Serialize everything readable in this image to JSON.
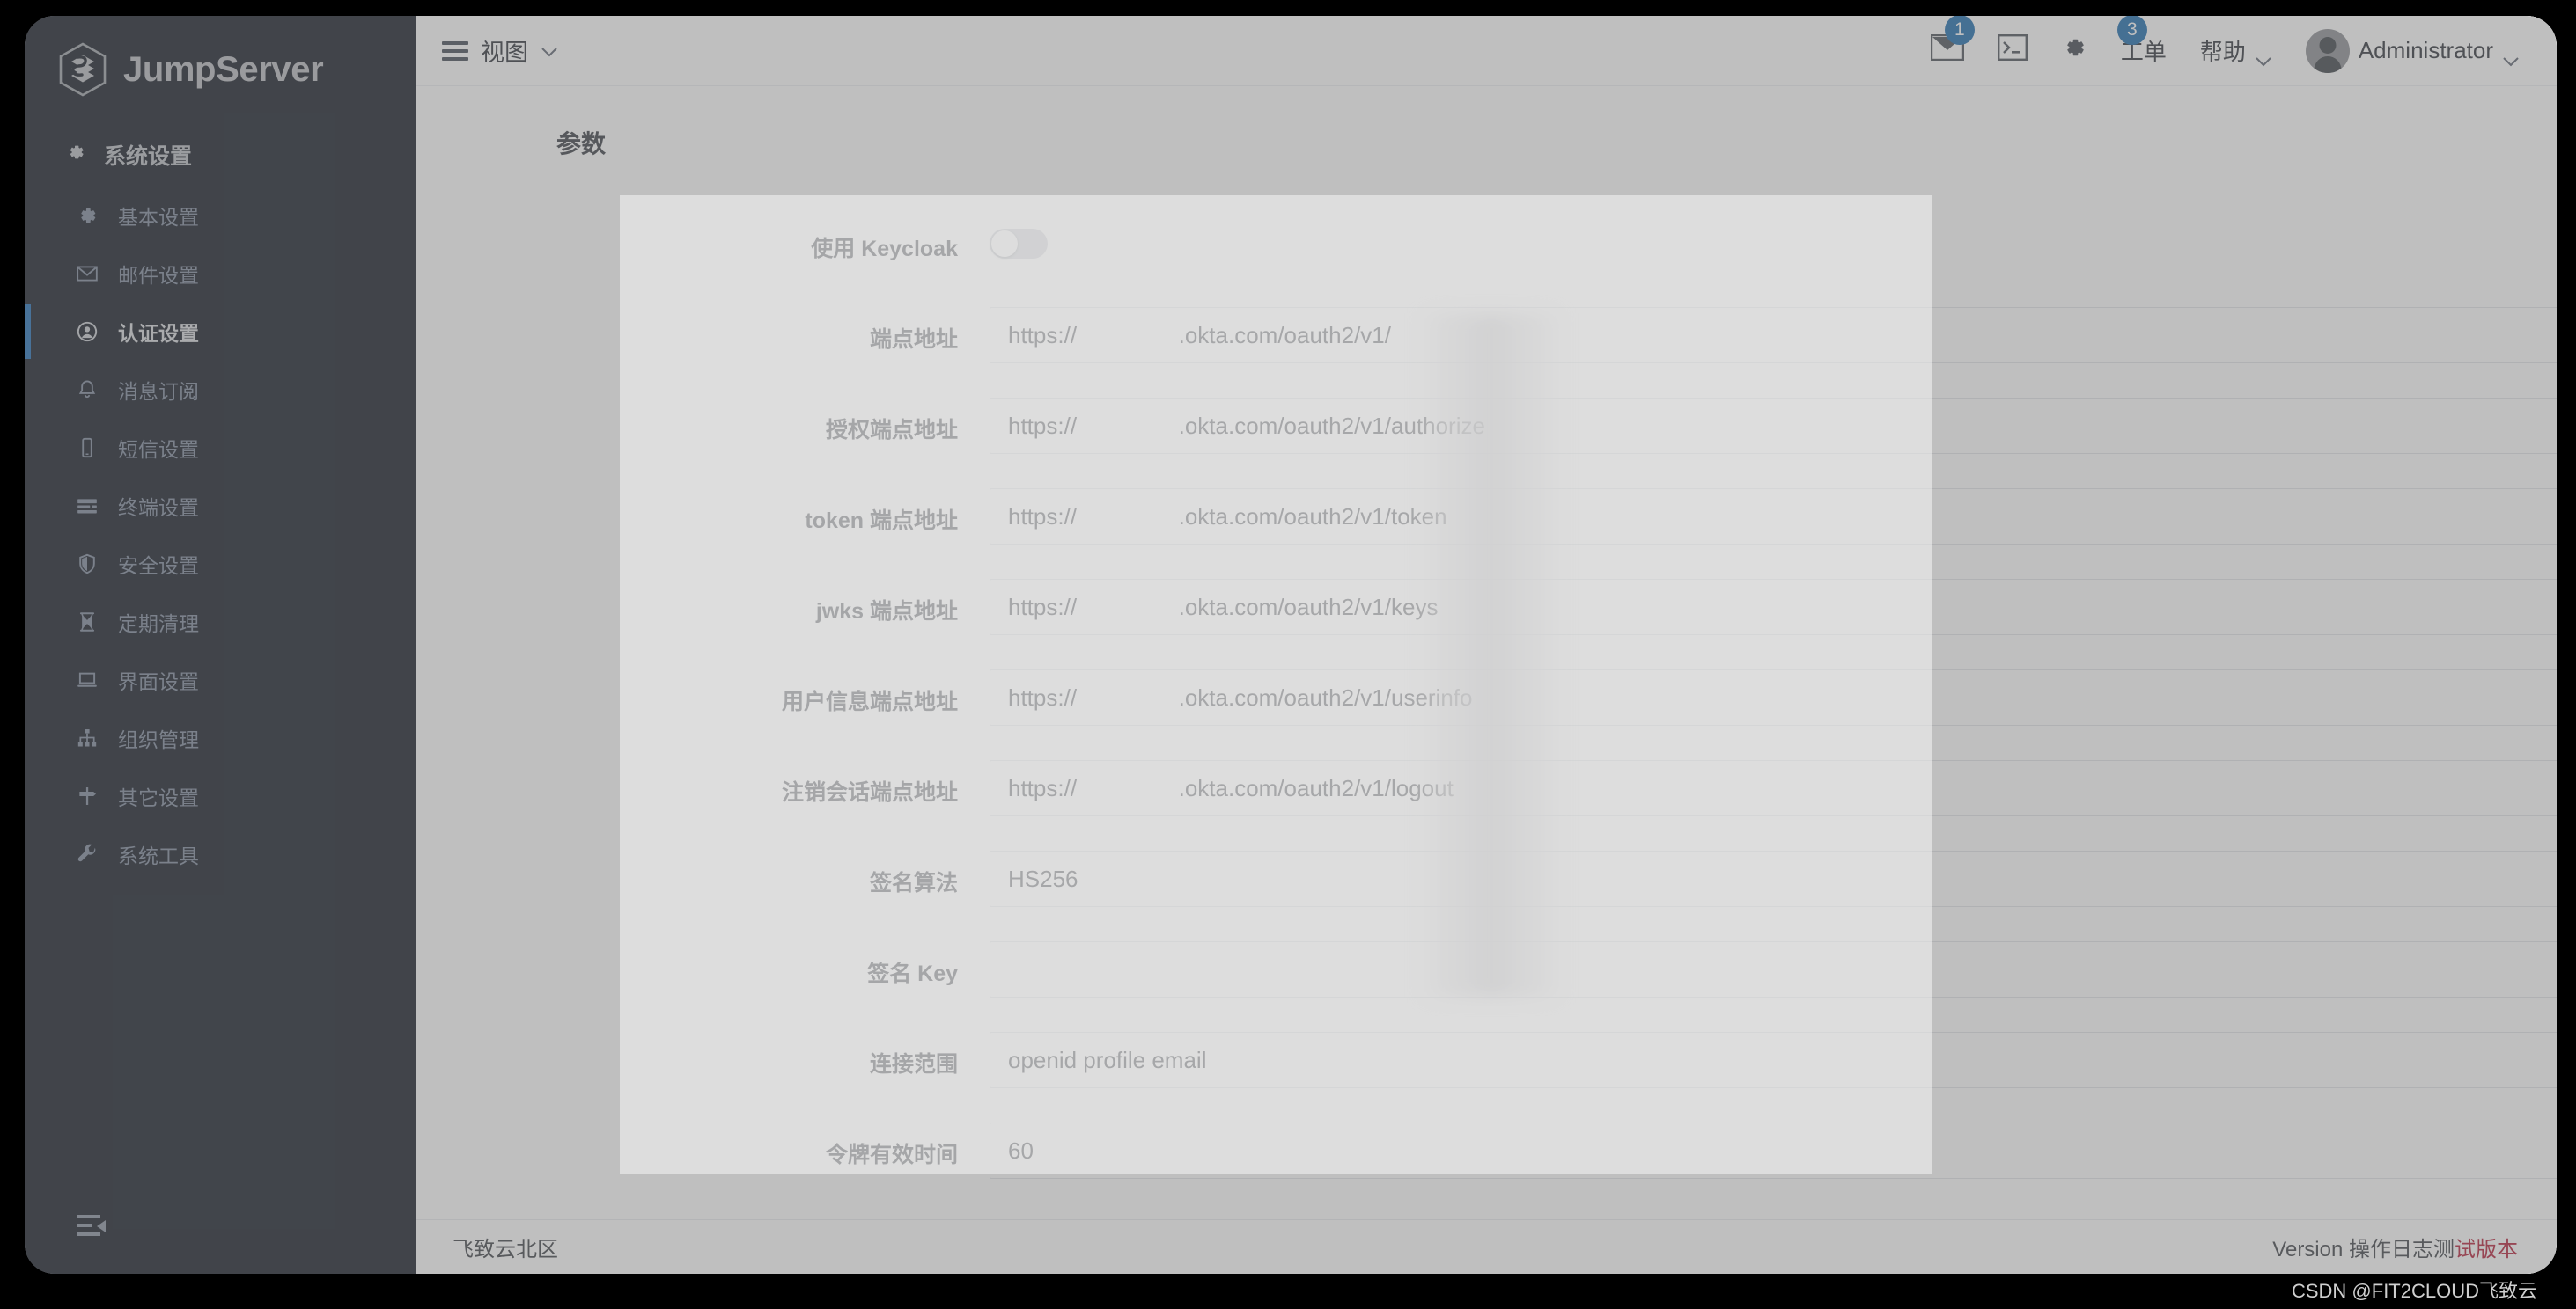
{
  "app": {
    "brand": "JumpServer",
    "brand_icon": "jumpserver-cube-logo"
  },
  "sidebar": {
    "section_title": "系统设置",
    "section_icon": "gear-icon",
    "collapse_icon": "menu-fold-icon",
    "items": [
      {
        "label": "基本设置",
        "icon": "gear-icon",
        "active": false
      },
      {
        "label": "邮件设置",
        "icon": "envelope-icon",
        "active": false
      },
      {
        "label": "认证设置",
        "icon": "user-circle-icon",
        "active": true
      },
      {
        "label": "消息订阅",
        "icon": "bell-icon",
        "active": false
      },
      {
        "label": "短信设置",
        "icon": "mobile-icon",
        "active": false
      },
      {
        "label": "终端设置",
        "icon": "server-icon",
        "active": false
      },
      {
        "label": "安全设置",
        "icon": "shield-icon",
        "active": false
      },
      {
        "label": "定期清理",
        "icon": "hourglass-icon",
        "active": false
      },
      {
        "label": "界面设置",
        "icon": "laptop-icon",
        "active": false
      },
      {
        "label": "组织管理",
        "icon": "sitemap-icon",
        "active": false
      },
      {
        "label": "其它设置",
        "icon": "signpost-icon",
        "active": false
      },
      {
        "label": "系统工具",
        "icon": "wrench-icon",
        "active": false
      }
    ]
  },
  "topbar": {
    "view_menu_label": "视图",
    "view_menu_icon": "hamburger-icon",
    "view_menu_chevron": "chevron-down-icon",
    "mail": {
      "icon": "envelope-icon",
      "badge": "1"
    },
    "terminal": {
      "icon": "terminal-icon"
    },
    "settings": {
      "icon": "gear-icon"
    },
    "tickets": {
      "label": "工单",
      "badge": "3"
    },
    "help": {
      "label": "帮助",
      "chevron": "chevron-down-icon"
    },
    "user": {
      "name": "Administrator",
      "avatar_icon": "user-avatar-icon",
      "chevron": "chevron-down-icon"
    }
  },
  "main": {
    "section_title": "参数",
    "fields": [
      {
        "label": "使用 Keycloak",
        "type": "toggle",
        "value": "off",
        "placeholder": ""
      },
      {
        "label": "端点地址",
        "type": "text",
        "value": "https://                .okta.com/oauth2/v1/",
        "placeholder": ""
      },
      {
        "label": "授权端点地址",
        "type": "text",
        "value": "https://                .okta.com/oauth2/v1/authorize",
        "placeholder": ""
      },
      {
        "label": "token 端点地址",
        "type": "text",
        "value": "https://                .okta.com/oauth2/v1/token",
        "placeholder": ""
      },
      {
        "label": "jwks 端点地址",
        "type": "text",
        "value": "https://                .okta.com/oauth2/v1/keys",
        "placeholder": ""
      },
      {
        "label": "用户信息端点地址",
        "type": "text",
        "value": "https://                .okta.com/oauth2/v1/userinfo",
        "placeholder": ""
      },
      {
        "label": "注销会话端点地址",
        "type": "text",
        "value": "https://                .okta.com/oauth2/v1/logout",
        "placeholder": ""
      },
      {
        "label": "签名算法",
        "type": "text",
        "value": "HS256",
        "placeholder": ""
      },
      {
        "label": "签名 Key",
        "type": "text",
        "value": "",
        "placeholder": ""
      },
      {
        "label": "连接范围",
        "type": "text",
        "value": "openid profile email",
        "placeholder": ""
      },
      {
        "label": "令牌有效时间",
        "type": "text",
        "value": "60",
        "placeholder": ""
      }
    ]
  },
  "footer": {
    "org": "飞致云北区",
    "version_prefix": "Version 操作日志测",
    "version_highlight": "试版本"
  },
  "watermark": "CSDN @FIT2CLOUD飞致云",
  "colors": {
    "sidebar_bg": "#111723",
    "accent_blue": "#1f6fb8",
    "badge_blue": "#1a6aad",
    "version_red": "#b31b35",
    "page_bg": "#ffffff"
  }
}
